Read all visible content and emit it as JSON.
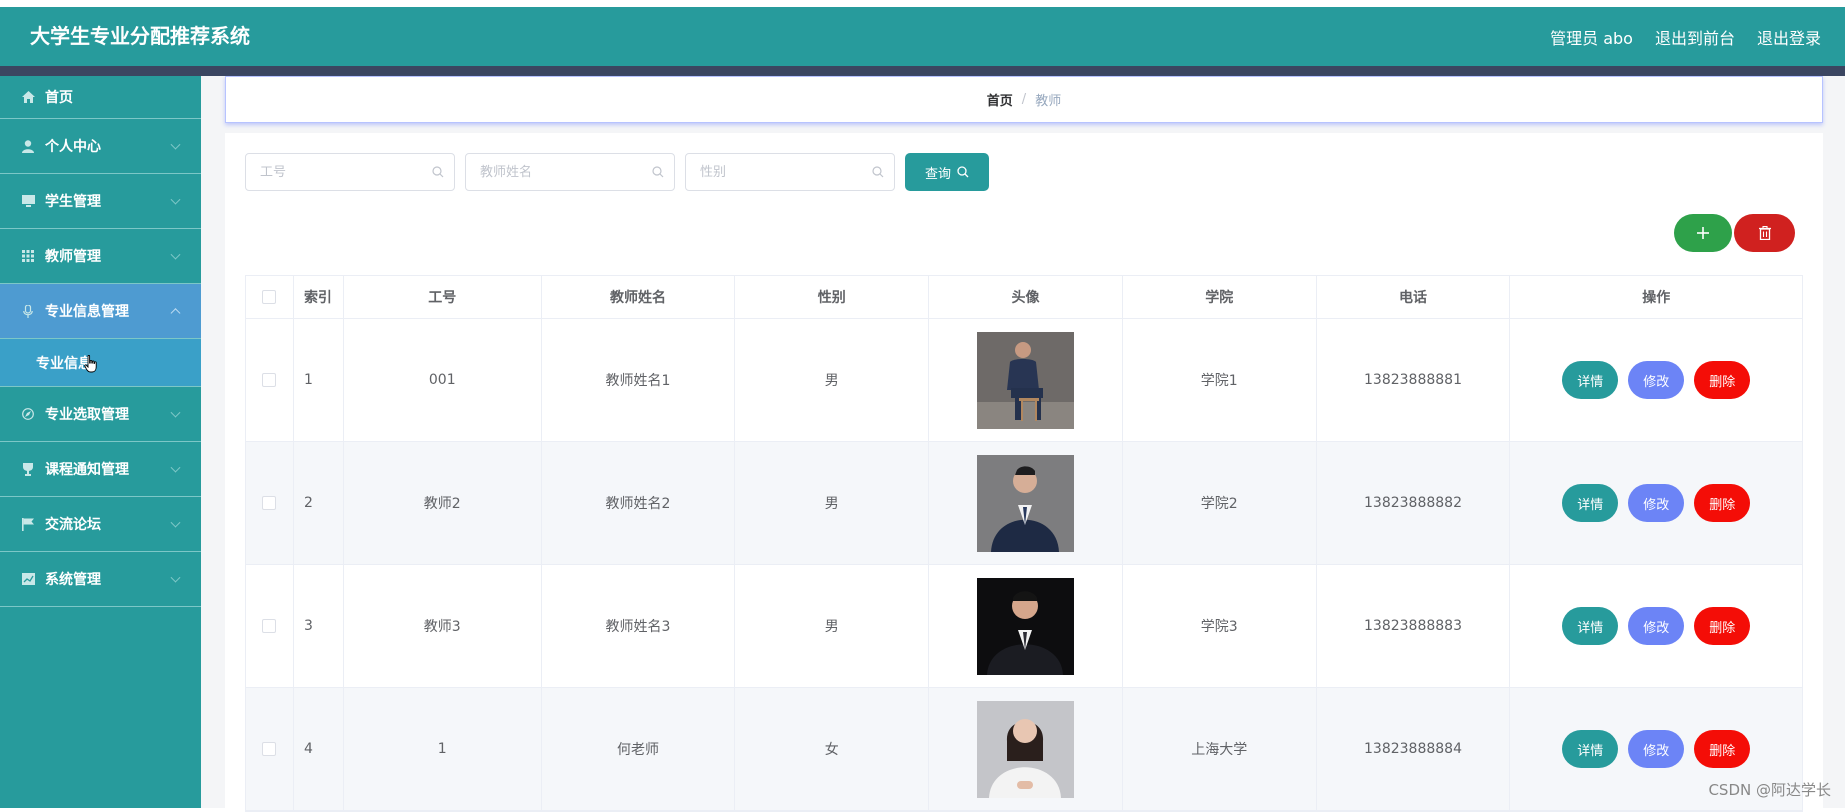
{
  "header": {
    "title": "大学生专业分配推荐系统",
    "user_label": "管理员 abo",
    "back_to_front": "退出到前台",
    "logout": "退出登录"
  },
  "sidebar": {
    "items": [
      {
        "label": "首页",
        "icon": "home-icon"
      },
      {
        "label": "个人中心",
        "icon": "user-icon"
      },
      {
        "label": "学生管理",
        "icon": "monitor-icon"
      },
      {
        "label": "教师管理",
        "icon": "grid-icon"
      },
      {
        "label": "专业信息管理",
        "icon": "microphone-icon",
        "expanded": true
      },
      {
        "label": "专业选取管理",
        "icon": "compass-icon"
      },
      {
        "label": "课程通知管理",
        "icon": "trophy-icon"
      },
      {
        "label": "交流论坛",
        "icon": "flag-icon"
      },
      {
        "label": "系统管理",
        "icon": "chart-icon"
      }
    ],
    "sub_item": "专业信息"
  },
  "breadcrumb": {
    "home": "首页",
    "separator": "/",
    "current": "教师"
  },
  "search": {
    "field1_placeholder": "工号",
    "field2_placeholder": "教师姓名",
    "field3_placeholder": "性别",
    "query_label": "查询"
  },
  "table": {
    "headers": [
      "索引",
      "工号",
      "教师姓名",
      "性别",
      "头像",
      "学院",
      "电话",
      "操作"
    ],
    "rows": [
      {
        "index": "1",
        "no": "001",
        "name": "教师姓名1",
        "sex": "男",
        "college": "学院1",
        "phone": "13823888881"
      },
      {
        "index": "2",
        "no": "教师2",
        "name": "教师姓名2",
        "sex": "男",
        "college": "学院2",
        "phone": "13823888882"
      },
      {
        "index": "3",
        "no": "教师3",
        "name": "教师姓名3",
        "sex": "男",
        "college": "学院3",
        "phone": "13823888883"
      },
      {
        "index": "4",
        "no": "1",
        "name": "何老师",
        "sex": "女",
        "college": "上海大学",
        "phone": "13823888884"
      }
    ],
    "ops": {
      "detail": "详情",
      "edit": "修改",
      "remove": "删除"
    }
  },
  "watermark": "CSDN @阿达学长",
  "colors": {
    "primary": "#279b9c",
    "header_dark": "#3b4661",
    "active_menu": "#4e9bd1",
    "add": "#2ea14a",
    "delete": "#d0211f",
    "edit": "#6c84f6",
    "remove": "#f40d07"
  }
}
